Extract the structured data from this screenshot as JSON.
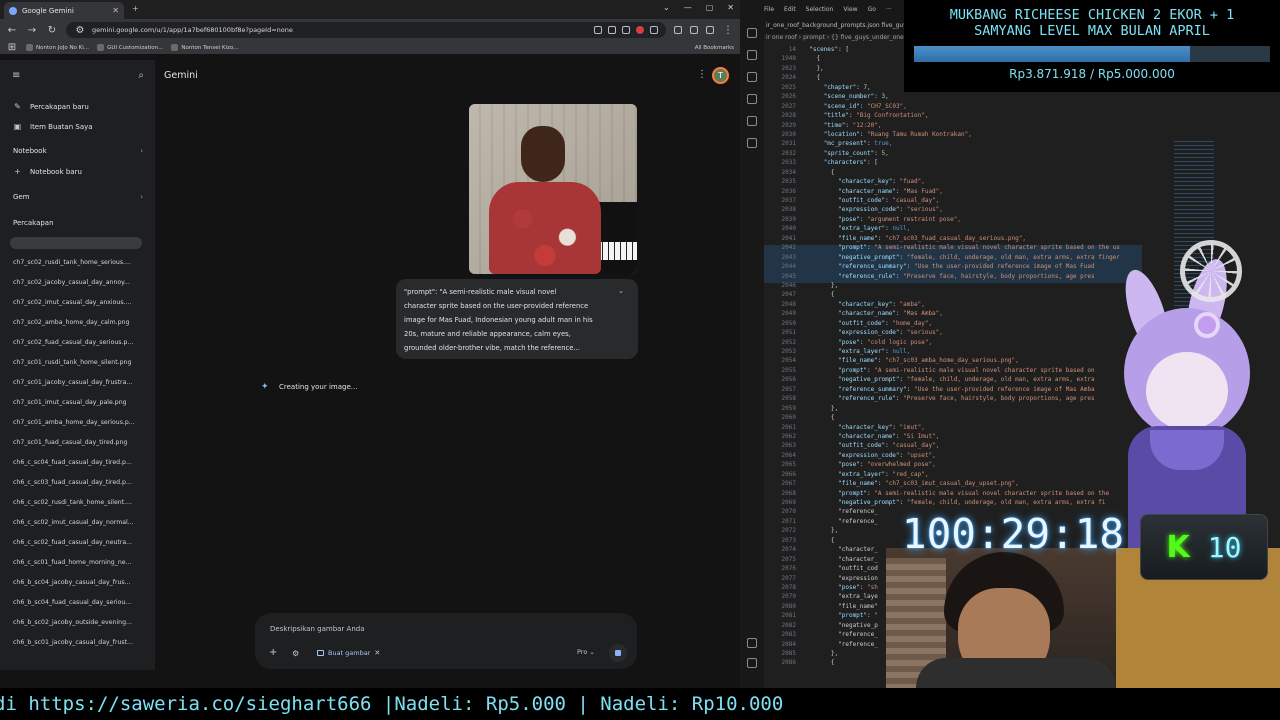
{
  "browser": {
    "tab_title": "Google Gemini",
    "url": "gemini.google.com/u/1/app/1a7bef680100bf8e?pageId=none",
    "bookmarks": [
      "Nonton JoJo No Ki...",
      "GUI Customization...",
      "Nonton Tensei Kizo..."
    ],
    "all_bookmarks": "All Bookmarks"
  },
  "gemini": {
    "title": "Gemini",
    "avatar_letter": "T",
    "sidebar": {
      "new_chat": "Percakapan baru",
      "my_stuff": "Item Buatan Saya",
      "notebook_header": "Notebook",
      "new_notebook": "Notebook baru",
      "gem_header": "Gem",
      "chats_header": "Percakapan",
      "chats": [
        "ch7_sc02_rusdi_tank_home_serious....",
        "ch7_sc02_jacoby_casual_day_annoy...",
        "ch7_sc02_imut_casual_day_anxious....",
        "ch7_sc02_amba_home_day_calm.png",
        "ch7_sc02_fuad_casual_day_serious.p...",
        "ch7_sc01_rusdi_tank_home_silent.png",
        "ch7_sc01_jacoby_casual_day_frustra...",
        "ch7_sc01_imut_casual_day_pale.png",
        "ch7_sc01_amba_home_day_serious.p...",
        "ch7_sc01_fuad_casual_day_tired.png",
        "ch6_c_sc04_fuad_casual_day_tired.p...",
        "ch6_c_sc03_fuad_casual_day_tired.p...",
        "ch6_c_sc02_rusdi_tank_home_silent....",
        "ch6_c_sc02_imut_casual_day_normal...",
        "ch6_c_sc02_fuad_casual_day_neutra...",
        "ch6_c_sc01_fuad_home_morning_ne...",
        "ch6_b_sc04_jacoby_casual_day_frus...",
        "ch6_b_sc04_fuad_casual_day_seriou...",
        "ch6_b_sc02_jacoby_outside_evening...",
        "ch6_b_sc01_jacoby_casual_day_frust..."
      ]
    },
    "prompt_text": "\"prompt\": \"A semi-realistic male visual novel\ncharacter sprite based on the user-provided reference\nimage for Mas Fuad, Indonesian young adult man in his\n20s, mature and reliable appearance, calm eyes,\ngrounded older-brother vibe, match the reference...",
    "status": "Creating your image...",
    "input": {
      "placeholder": "Deskripsikan gambar Anda",
      "chip_label": "Buat gambar",
      "model": "Pro"
    }
  },
  "vscode": {
    "menu": [
      "File",
      "Edit",
      "Selection",
      "View",
      "Go",
      "···"
    ],
    "tabs": "ir_one_roof_background_prompts.json     five_guys_under_one",
    "breadcrumb": "ir one roof › prompt › {} five_guys_under_one",
    "line_numbers": [
      "14",
      "1948",
      "2023",
      "2024",
      "2025",
      "2026",
      "2027",
      "2028",
      "2029",
      "2030",
      "2031",
      "2032",
      "2033",
      "2034",
      "2035",
      "2036",
      "2037",
      "2038",
      "2039",
      "2040",
      "2041",
      "2042",
      "2043",
      "2044",
      "2045",
      "2046",
      "2047",
      "2048",
      "2049",
      "2050",
      "2051",
      "2052",
      "2053",
      "2054",
      "2055",
      "2056",
      "2057",
      "2058",
      "2059",
      "2060",
      "2061",
      "2062",
      "2063",
      "2064",
      "2065",
      "2066",
      "2067",
      "2068",
      "2069",
      "2070",
      "2071",
      "2072",
      "2073",
      "2074",
      "2075",
      "2076",
      "2077",
      "2078",
      "2079",
      "2080",
      "2081",
      "2082",
      "2083",
      "2084",
      "2085",
      "2086"
    ],
    "code_lines": [
      "  \"scenes\": [",
      "    {",
      "    },",
      "    {",
      "      \"chapter\": 7,",
      "      \"scene_number\": 3,",
      "      \"scene_id\": \"CH7_SC03\",",
      "      \"title\": \"Big Confrontation\",",
      "      \"time\": \"12:20\",",
      "      \"location\": \"Ruang Tamu Rumah Kontrakan\",",
      "      \"mc_present\": true,",
      "      \"sprite_count\": 5,",
      "      \"characters\": [",
      "        {",
      "          \"character_key\": \"fuad\",",
      "          \"character_name\": \"Mas Fuad\",",
      "          \"outfit_code\": \"casual_day\",",
      "          \"expression_code\": \"serious\",",
      "          \"pose\": \"argument restraint pose\",",
      "          \"extra_layer\": null,",
      "          \"file_name\": \"ch7_sc03_fuad_casual_day_serious.png\",",
      "          \"prompt\": \"A semi-realistic male visual novel character sprite based on the us",
      "          \"negative_prompt\": \"female, child, underage, old man, extra arms, extra finger",
      "          \"reference_summary\": \"Use the user-provided reference image of Mas Fuad",
      "          \"reference_rule\": \"Preserve face, hairstyle, body proportions, age pres",
      "        },",
      "        {",
      "          \"character_key\": \"amba\",",
      "          \"character_name\": \"Mas Amba\",",
      "          \"outfit_code\": \"home_day\",",
      "          \"expression_code\": \"serious\",",
      "          \"pose\": \"cold logic pose\",",
      "          \"extra_layer\": null,",
      "          \"file_name\": \"ch7_sc03_amba_home_day_serious.png\",",
      "          \"prompt\": \"A semi-realistic male visual novel character sprite based on",
      "          \"negative_prompt\": \"female, child, underage, old man, extra arms, extra",
      "          \"reference_summary\": \"Use the user-provided reference image of Mas Amba",
      "          \"reference_rule\": \"Preserve face, hairstyle, body proportions, age pres",
      "        },",
      "        {",
      "          \"character_key\": \"imut\",",
      "          \"character_name\": \"Si Imut\",",
      "          \"outfit_code\": \"casual_day\",",
      "          \"expression_code\": \"upset\",",
      "          \"pose\": \"overwhelmed pose\",",
      "          \"extra_layer\": \"red_cap\",",
      "          \"file_name\": \"ch7_sc03_imut_casual_day_upset.png\",",
      "          \"prompt\": \"A semi-realistic male visual novel character sprite based on the",
      "          \"negative_prompt\": \"female, child, underage, old man, extra arms, extra fi",
      "          \"reference_",
      "          \"reference_",
      "        },",
      "        {",
      "          \"character_",
      "          \"character_",
      "          \"outfit_cod",
      "          \"expression",
      "          \"pose\": \"sh",
      "          \"extra_laye",
      "          \"file_name\"",
      "          \"prompt\": \"",
      "          \"negative_p",
      "          \"reference_",
      "          \"reference_",
      "        },",
      "        {"
    ]
  },
  "donation": {
    "title": "MUKBANG RICHEESE CHICKEN 2 EKOR + 1\nSAMYANG LEVEL MAX BULAN APRIL",
    "current": 3871918,
    "goal": 5000000,
    "progress_fraction": 0.774,
    "amount_text": "Rp3.871.918 / Rp5.000.000"
  },
  "stream": {
    "timer": "100:29:18",
    "kick_count": "10",
    "ticker": "di https://saweria.co/sieghart666 |Nadeli: Rp5.000 | Nadeli: Rp10.000"
  },
  "colors": {
    "overlay_cyan": "#7ee0f2",
    "kick_green": "#53fc18",
    "gemini_blue": "#8ab4f8"
  }
}
